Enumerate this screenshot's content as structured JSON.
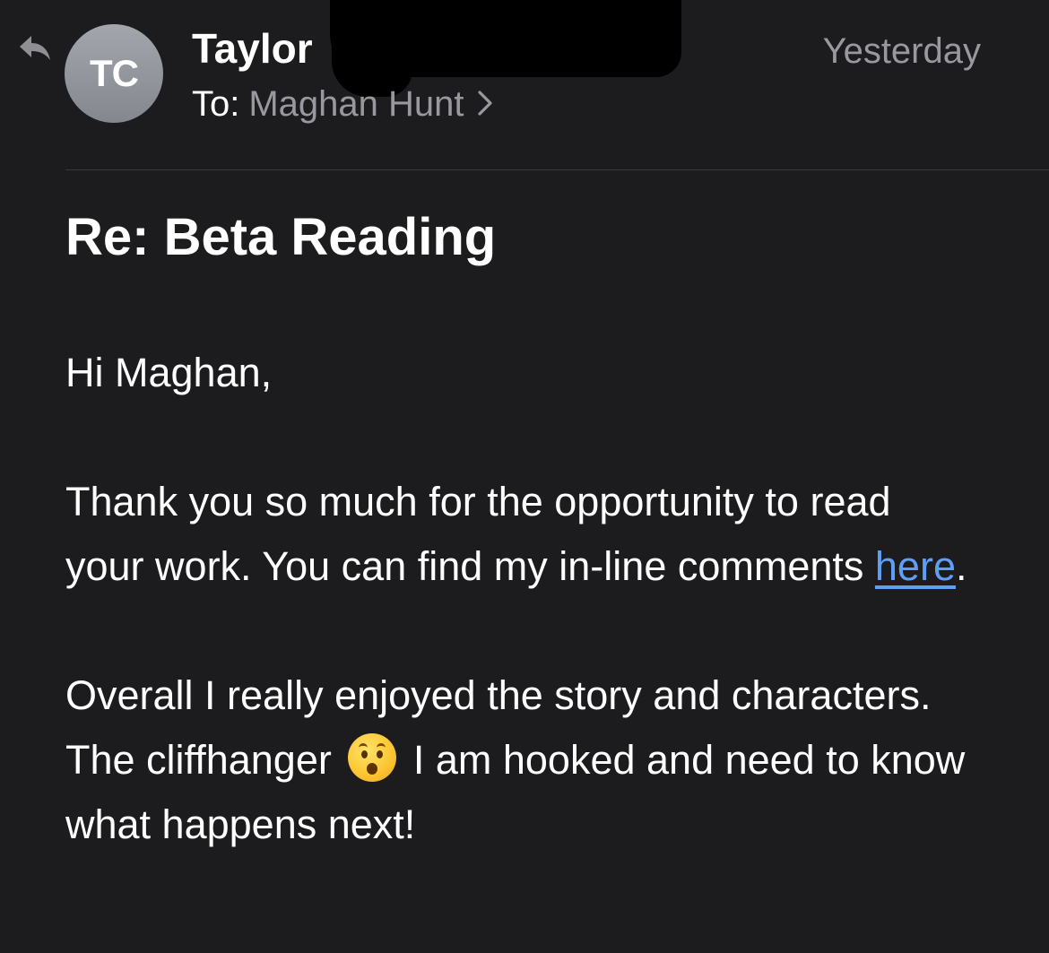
{
  "header": {
    "avatar_initials": "TC",
    "sender_name": "Taylor",
    "to_label": "To:",
    "recipient": "Maghan Hunt",
    "date": "Yesterday"
  },
  "message": {
    "subject": "Re: Beta Reading",
    "greeting": "Hi Maghan,",
    "para1_text": "Thank you so much for the opportunity to read your work. You can find my in-line comments ",
    "para1_link": "here",
    "para1_end": ".",
    "para2_start": "Overall I really enjoyed the story and characters. The cliffhanger ",
    "para2_emoji": "hushed-face-emoji",
    "para2_end": " I am hooked and need to know what happens next!"
  },
  "colors": {
    "background": "#1c1c1e",
    "secondary_text": "#98989f",
    "link": "#5e9ef5",
    "divider": "#3a3a3c"
  },
  "icons": {
    "reply": "reply-arrow-icon",
    "disclosure": "chevron-right-icon"
  }
}
